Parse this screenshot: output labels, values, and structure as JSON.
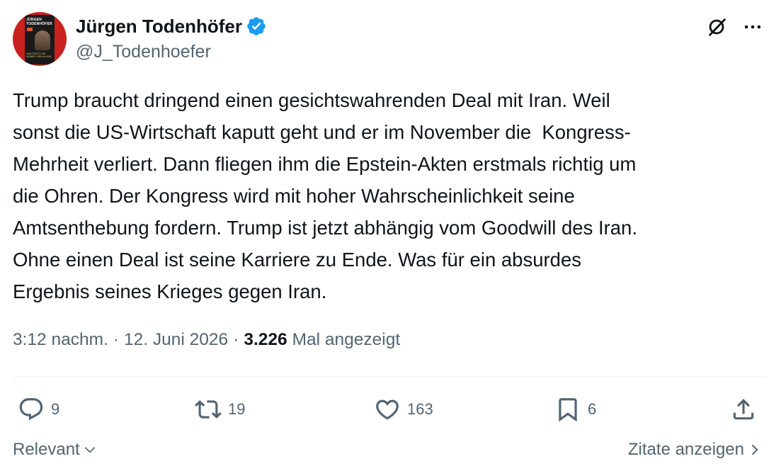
{
  "author": {
    "display_name": "Jürgen Todenhöfer",
    "handle": "@J_Todenhoefer",
    "verified": true,
    "avatar": {
      "book_title": "JÜRGEN TODENHÖFER",
      "book_subtitle": "UND FOLGT DIR KEINER, GEH ALLEIN"
    }
  },
  "header_actions": {
    "grok_icon": "grok-icon",
    "more_icon": "more-icon"
  },
  "tweet": {
    "text": "Trump braucht dringend einen gesichtswahrenden Deal mit Iran. Weil\nsonst die US-Wirtschaft kaputt geht und er im November die  Kongress-\nMehrheit verliert. Dann fliegen ihm die Epstein-Akten erstmals richtig um\ndie Ohren. Der Kongress wird mit hoher Wahrscheinlichkeit seine\nAmtsenthebung fordern. Trump ist jetzt abhängig vom Goodwill des Iran.\nOhne einen Deal ist seine Karriere zu Ende. Was für ein absurdes\nErgebnis seines Krieges gegen Iran."
  },
  "meta": {
    "time": "3:12 nachm.",
    "separator": "·",
    "date": "12. Juni 2026",
    "views_count": "3.226",
    "views_label": "Mal angezeigt"
  },
  "actions": {
    "replies": "9",
    "retweets": "19",
    "likes": "163",
    "bookmarks": "6"
  },
  "footer": {
    "sort_label": "Relevant",
    "quotes_label": "Zitate anzeigen"
  },
  "colors": {
    "text_primary": "#0f1419",
    "text_secondary": "#536471",
    "verified_blue": "#1d9bf0",
    "divider": "#eff3f4"
  }
}
